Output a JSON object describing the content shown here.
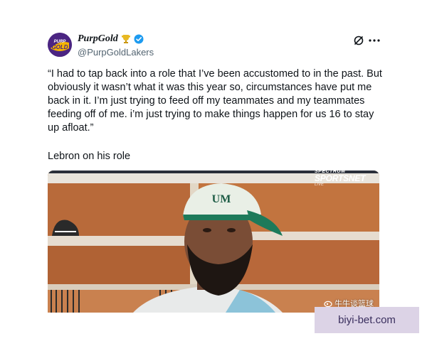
{
  "account": {
    "display_name": "PurpGold",
    "handle": "@PurpGoldLakers",
    "avatar_text": "PURP GOLD"
  },
  "tweet": {
    "text": "“I had to tap back into a role that I’ve been accustomed to in the past. But obviously it wasn’t what it was this year so, circumstances have put me back in it. I’m just trying to feed off my teammates and my teammates feeding off of me. i’m just trying to make things happen for us 16 to stay up afloat.”",
    "caption": "Lebron on his role"
  },
  "media": {
    "network_top": "SPECTRUM",
    "network_name": "SPORTSNET",
    "network_sub": "LIVE",
    "cap_logo": "UM",
    "source_watermark": "牛牛谈篮球"
  },
  "banner": {
    "site": "biyi-bet.com"
  },
  "colors": {
    "handle_gray": "#536471",
    "verified_blue": "#1d9bf0",
    "trophy_gold": "#e8b923",
    "banner_bg": "#dcd3e6"
  },
  "icons": [
    "trophy-icon",
    "verified-icon",
    "grok-icon",
    "more-icon",
    "weibo-icon"
  ]
}
